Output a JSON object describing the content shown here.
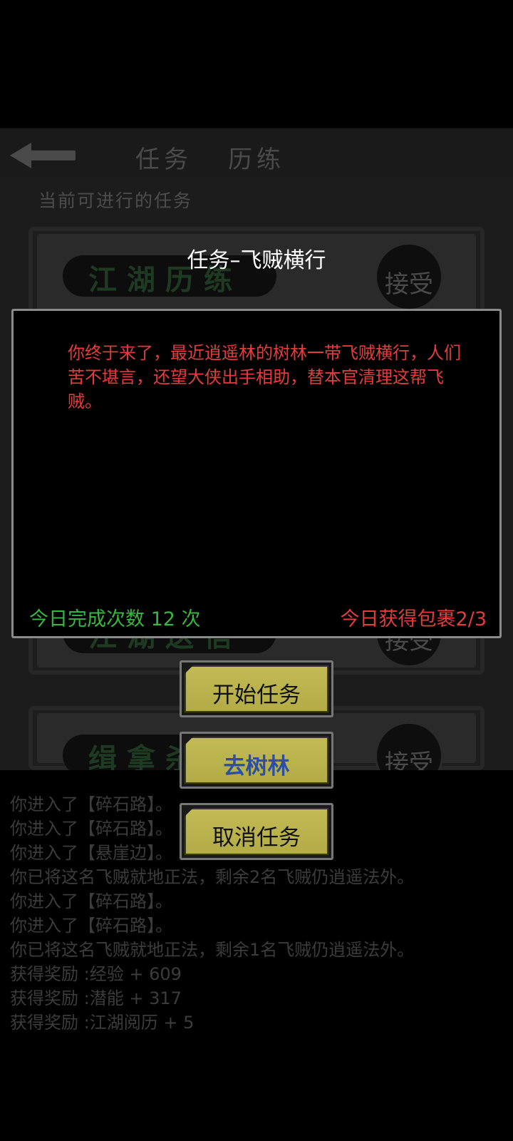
{
  "background": {
    "tabs": [
      "任务",
      "历练"
    ],
    "subtitle": "当前可进行的任务",
    "cards": [
      {
        "name": "江湖历练",
        "accept": "接受"
      },
      {
        "name": "江湖送信",
        "accept": "接受"
      },
      {
        "name": "缉拿杀",
        "accept": "接受"
      }
    ],
    "log": [
      "你进入了【碎石路】。",
      "你进入了【碎石路】。",
      "你进入了【悬崖边】。",
      "你已将这名飞贼就地正法，剩余2名飞贼仍逍遥法外。",
      "你进入了【碎石路】。",
      "你进入了【碎石路】。",
      "你已将这名飞贼就地正法，剩余1名飞贼仍逍遥法外。",
      "获得奖励 :经验 + 609",
      "获得奖励 :潜能 + 317",
      "获得奖励 :江湖阅历 + 5"
    ]
  },
  "modal": {
    "title": "任务–飞贼横行",
    "description": "你终于来了，最近逍遥林的树林一带飞贼横行，人们苦不堪言，还望大侠出手相助，替本官清理这帮飞贼。",
    "count_text": "今日完成次数 12 次",
    "package_text": "今日获得包裹2/3"
  },
  "buttons": {
    "start": "开始任务",
    "go": "去树林",
    "cancel": "取消任务"
  },
  "colors": {
    "description_red": "#e23c3c",
    "count_green": "#37b640",
    "button_gold": "#c2bb55",
    "go_blue": "#2c4fa6"
  }
}
